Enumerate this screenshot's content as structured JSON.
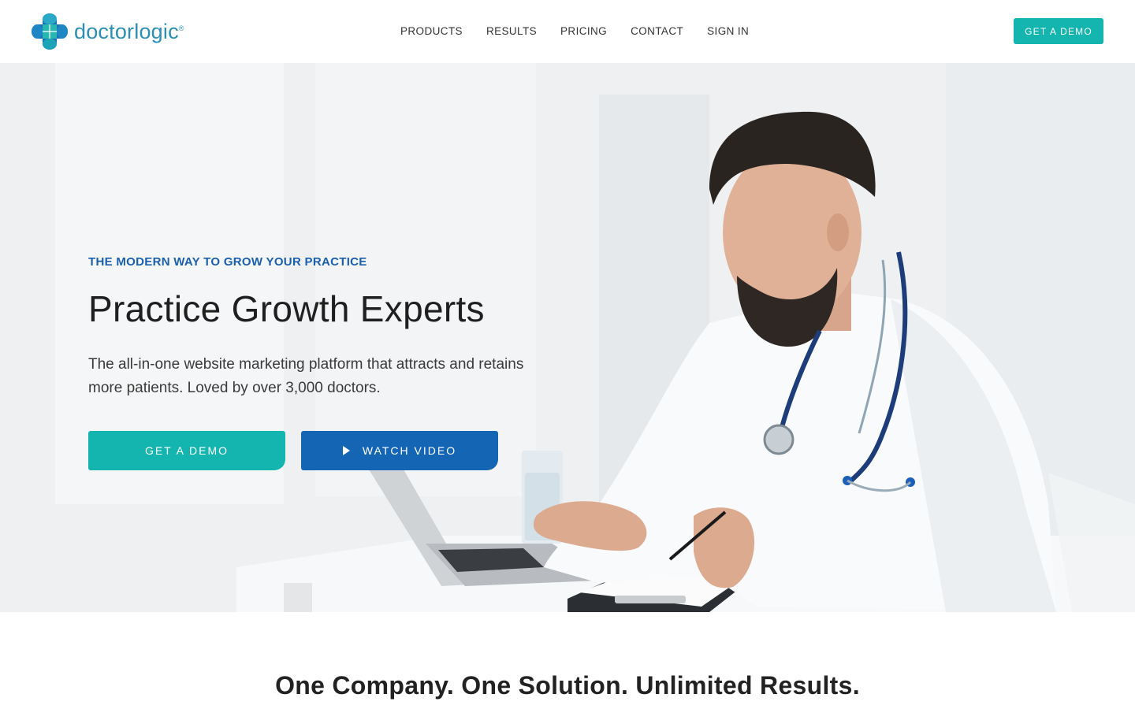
{
  "brand": {
    "name": "doctorlogic",
    "registered_mark": "®",
    "colors": {
      "teal": "#14b5ae",
      "blue": "#1565b5",
      "logo_text": "#2a8fb3"
    }
  },
  "nav": {
    "items": [
      {
        "label": "PRODUCTS"
      },
      {
        "label": "RESULTS"
      },
      {
        "label": "PRICING"
      },
      {
        "label": "CONTACT"
      },
      {
        "label": "SIGN IN"
      }
    ],
    "cta_label": "GET A DEMO"
  },
  "hero": {
    "eyebrow": "THE MODERN WAY TO GROW YOUR PRACTICE",
    "headline": "Practice Growth Experts",
    "subtext": "The all-in-one website marketing platform that attracts and retains more patients. Loved by over 3,000 doctors.",
    "primary_button": "GET A DEMO",
    "secondary_button": "WATCH VIDEO",
    "secondary_icon": "play-icon",
    "image_subject": "doctor-at-laptop-photo"
  },
  "section": {
    "title": "One Company. One Solution. Unlimited Results."
  }
}
